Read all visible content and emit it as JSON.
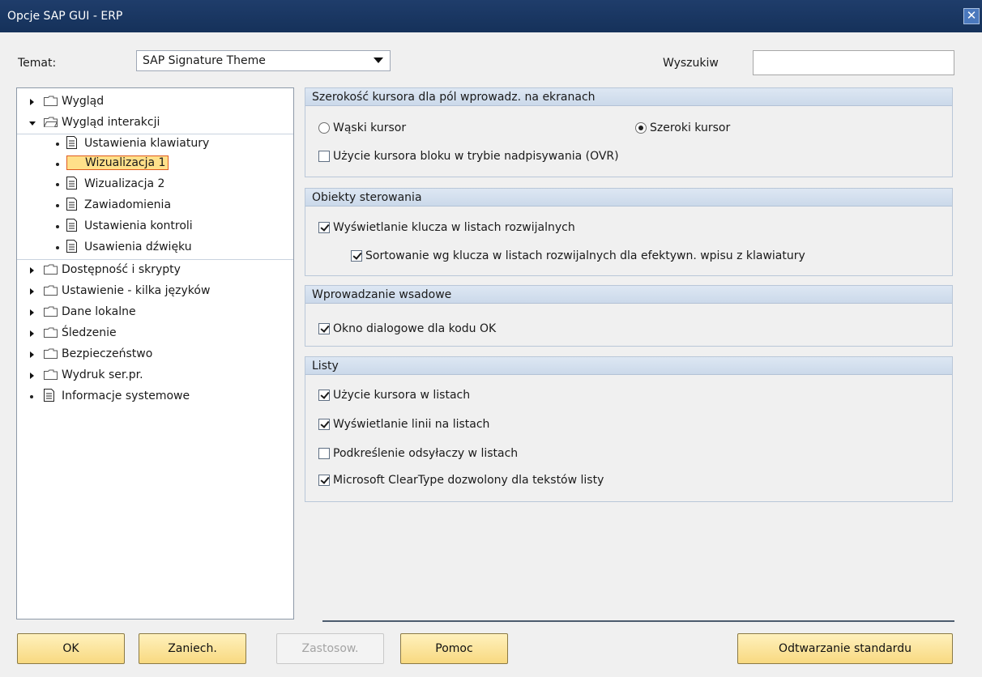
{
  "window": {
    "title": "Opcje SAP GUI - ERP",
    "close_glyph": "✕"
  },
  "theme": {
    "label": "Temat:",
    "value": "SAP Signature Theme"
  },
  "search": {
    "label": "Wyszukiw",
    "value": ""
  },
  "tree": {
    "items": [
      {
        "label": "Wygląd",
        "type": "folder",
        "state": "collapsed"
      },
      {
        "label": "Wygląd interakcji",
        "type": "folder",
        "state": "expanded"
      },
      {
        "label": "Ustawienia klawiatury",
        "type": "doc"
      },
      {
        "label": "Wizualizacja 1",
        "type": "doc",
        "selected": true
      },
      {
        "label": "Wizualizacja 2",
        "type": "doc"
      },
      {
        "label": "Zawiadomienia",
        "type": "doc"
      },
      {
        "label": "Ustawienia kontroli",
        "type": "doc"
      },
      {
        "label": "Usawienia dźwięku",
        "type": "doc"
      },
      {
        "label": "Dostępność i skrypty",
        "type": "folder",
        "state": "collapsed"
      },
      {
        "label": "Ustawienie - kilka języków",
        "type": "folder",
        "state": "collapsed"
      },
      {
        "label": "Dane lokalne",
        "type": "folder",
        "state": "collapsed"
      },
      {
        "label": "Śledzenie",
        "type": "folder",
        "state": "collapsed"
      },
      {
        "label": "Bezpieczeństwo",
        "type": "folder",
        "state": "collapsed"
      },
      {
        "label": "Wydruk ser.pr.",
        "type": "folder",
        "state": "collapsed"
      },
      {
        "label": "Informacje systemowe",
        "type": "doc"
      }
    ]
  },
  "groups": {
    "cursor": {
      "title": "Szerokość kursora dla pól wprowadz. na ekranach",
      "narrow": "Wąski kursor",
      "wide": "Szeroki kursor",
      "selected": "wide",
      "block_cursor": "Użycie kursora bloku w trybie nadpisywania (OVR)",
      "block_cursor_checked": false
    },
    "controls": {
      "title": "Obiekty sterowania",
      "show_key": "Wyświetlanie klucza w listach rozwijalnych",
      "show_key_checked": true,
      "sort_key": "Sortowanie wg klucza w listach rozwijalnych dla efektywn. wpisu z klawiatury",
      "sort_key_checked": true
    },
    "batch": {
      "title": "Wprowadzanie wsadowe",
      "dialog_ok": "Okno dialogowe dla kodu OK",
      "dialog_ok_checked": true
    },
    "lists": {
      "title": "Listy",
      "items": [
        {
          "label": "Użycie kursora w listach",
          "checked": true
        },
        {
          "label": "Wyświetlanie linii na listach",
          "checked": true
        },
        {
          "label": "Podkreślenie odsyłaczy w listach",
          "checked": false
        },
        {
          "label": "Microsoft ClearType dozwolony dla tekstów listy",
          "checked": true
        }
      ]
    }
  },
  "buttons": {
    "ok": "OK",
    "cancel": "Zaniech.",
    "apply": "Zastosow.",
    "help": "Pomoc",
    "restore": "Odtwarzanie standardu"
  },
  "icons": {
    "folder": "folder-icon",
    "document": "document-icon",
    "expand": "triangle-right-icon",
    "collapse": "triangle-down-icon"
  },
  "colors": {
    "title_bar": "#1f3d6b",
    "button_bg": "#f8d980",
    "selection_bg": "#ffe08a",
    "selection_border": "#e05a1e",
    "group_header": "#cbd9ea"
  }
}
